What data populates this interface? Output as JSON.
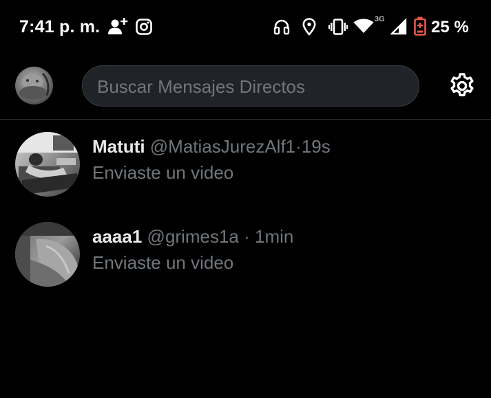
{
  "status_bar": {
    "time": "7:41 p. m.",
    "network_type": "3G",
    "battery_percent": "25 %",
    "icons": [
      "add-person-icon",
      "instagram-icon",
      "headphones-icon",
      "location-icon",
      "vibrate-icon",
      "wifi-icon",
      "signal-icon",
      "battery-icon"
    ],
    "battery_color": "#e45a4a"
  },
  "header": {
    "search_placeholder": "Buscar Mensajes Directos",
    "settings_icon": "gear-icon"
  },
  "conversations": [
    {
      "name": "Matuti",
      "handle": "@MatiasJurezAlf1",
      "separator": "·",
      "time": "19s",
      "preview": "Enviaste un video"
    },
    {
      "name": "aaaa1",
      "handle": "@grimes1a",
      "separator": "·",
      "time": "1min",
      "preview": "Enviaste un video"
    }
  ],
  "colors": {
    "background": "#000000",
    "primary_text": "#e7e9ea",
    "secondary_text": "#71767b",
    "search_background": "#202327",
    "divider": "#2f3336"
  }
}
